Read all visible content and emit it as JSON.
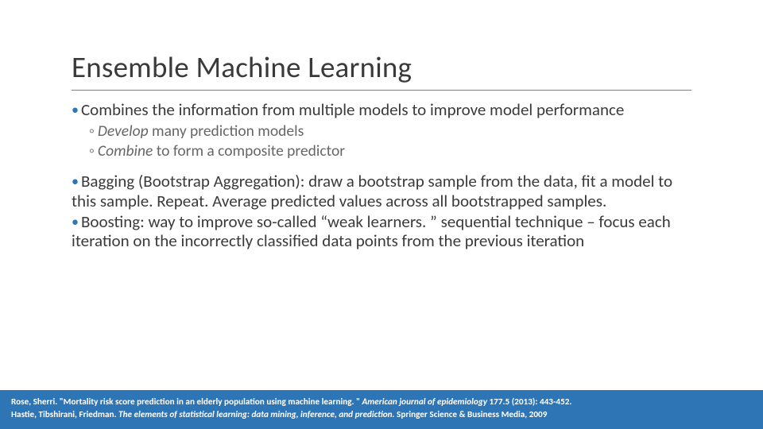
{
  "title": "Ensemble Machine Learning",
  "bullets": {
    "b1": "Combines the information from multiple models to improve model performance",
    "b1a_em": "Develop",
    "b1a_rest": " many prediction models",
    "b1b_em": "Combine",
    "b1b_rest": " to form a composite predictor",
    "b2": "Bagging (Bootstrap Aggregation): draw a bootstrap sample from the data, fit a model to this sample. Repeat. Average predicted values across all bootstrapped samples.",
    "b3": "Boosting: way to improve so-called “weak learners. ” sequential technique – focus each iteration on the incorrectly classified data points from the previous iteration"
  },
  "footer": {
    "ref1_bold_a": "Rose, Sherri. \"Mortality risk score prediction in an elderly population using machine learning. \" ",
    "ref1_ital": "American journal of epidemiology",
    "ref1_bold_b": " 177.5 (2013): 443-452.",
    "ref2_bold_a": "Hastie, Tibshirani, Friedman. ",
    "ref2_ital": "The elements of statistical learning: data mining, inference, and prediction.",
    "ref2_bold_b": " Springer Science & Business Media, 2009"
  }
}
